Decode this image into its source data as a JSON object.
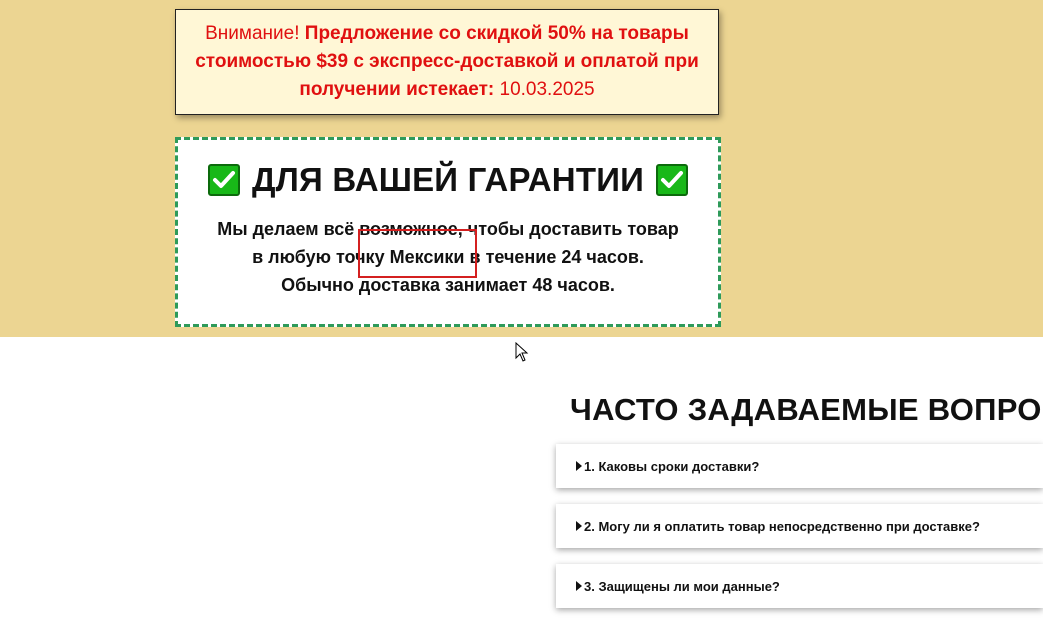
{
  "notice": {
    "prefix": "Внимание!",
    "message": "Предложение со скидкой 50% на товары стоимостью $39 с экспресс-доставкой и оплатой при получении истекает:",
    "date": "10.03.2025"
  },
  "guarantee": {
    "title": "ДЛЯ ВАШЕЙ ГАРАНТИИ",
    "line1": "Мы делаем всё возможное, чтобы доставить товар",
    "line2": "в любую точку Мексики в течение 24 часов.",
    "line3": "Обычно доставка занимает 48 часов."
  },
  "faq": {
    "title": "ЧАСТО ЗАДАВАЕМЫЕ ВОПРОСЫ",
    "items": [
      "1. Каковы сроки доставки?",
      "2. Могу ли я оплатить товар непосредственно при доставке?",
      "3. Защищены ли мои данные?"
    ]
  },
  "colors": {
    "band": "#ecd592",
    "notice_bg": "#fff7d6",
    "notice_text": "#e01010",
    "dashed_border": "#2e9a5a",
    "check_green": "#18b818",
    "highlight": "#d42020"
  }
}
